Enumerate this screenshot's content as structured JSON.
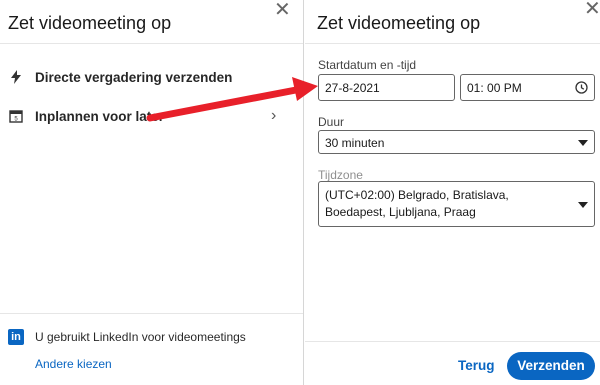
{
  "left": {
    "title": "Zet videomeeting op",
    "options": [
      {
        "label": "Directe vergadering verzenden",
        "icon": "lightning-icon"
      },
      {
        "label": "Inplannen voor later",
        "icon": "calendar-icon"
      }
    ],
    "footer": {
      "provider_logo_text": "in",
      "provider_text": "U gebruikt LinkedIn voor videomeetings",
      "change_link": "Andere kiezen"
    }
  },
  "right": {
    "title": "Zet videomeeting op",
    "start_label": "Startdatum en -tijd",
    "date_value": "27-8-2021",
    "time_value": "01: 00 PM",
    "duration_label": "Duur",
    "duration_value": "30 minuten",
    "timezone_label": "Tijdzone",
    "timezone_value": "(UTC+02:00) Belgrado, Bratislava, Boedapest, Ljubljana, Praag",
    "back_button": "Terug",
    "send_button": "Verzenden"
  },
  "colors": {
    "accent": "#0a66c2",
    "annotation_arrow": "#e8202a"
  }
}
